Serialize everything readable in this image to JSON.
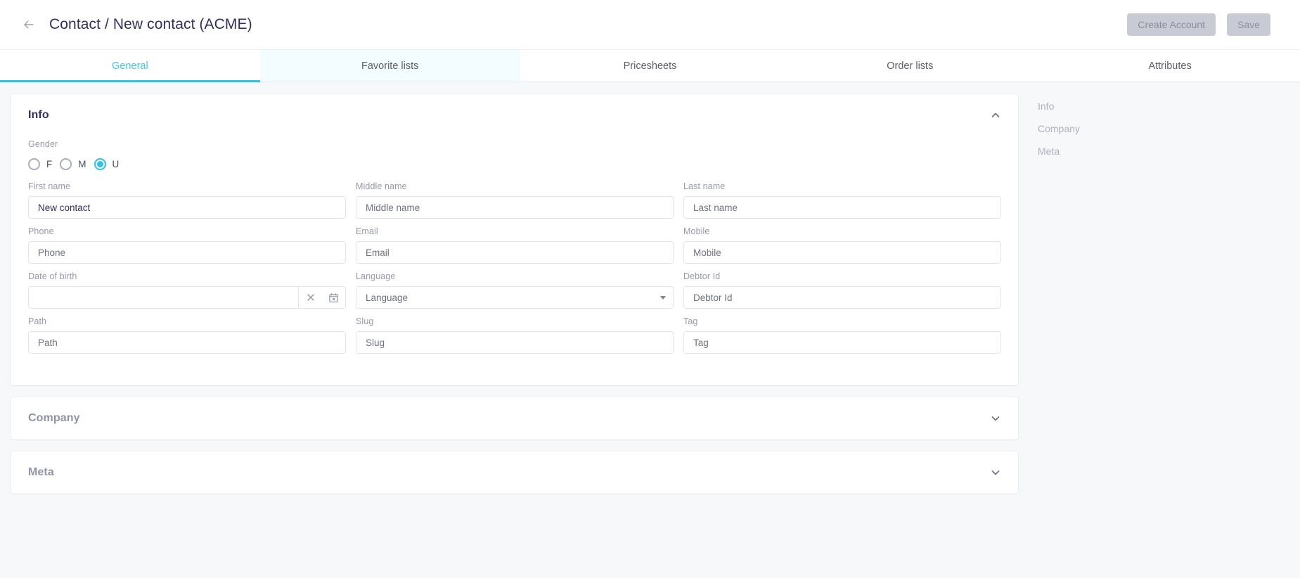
{
  "header": {
    "back_icon": "arrow-left-icon",
    "title": "Contact / New contact (ACME)",
    "create_account_label": "Create Account",
    "save_label": "Save"
  },
  "tabs": [
    {
      "label": "General",
      "state": "active"
    },
    {
      "label": "Favorite lists",
      "state": "hover"
    },
    {
      "label": "Pricesheets",
      "state": "default"
    },
    {
      "label": "Order lists",
      "state": "default"
    },
    {
      "label": "Attributes",
      "state": "default"
    }
  ],
  "sections": {
    "info": {
      "title": "Info",
      "collapsed": false,
      "chevron": "chevron-up-icon",
      "gender": {
        "label": "Gender",
        "options": [
          {
            "label": "F",
            "checked": false
          },
          {
            "label": "M",
            "checked": false
          },
          {
            "label": "U",
            "checked": true
          }
        ]
      },
      "fields": [
        [
          {
            "name": "first-name",
            "label": "First name",
            "value": "New contact",
            "placeholder": "First name",
            "filled": true,
            "type": "text"
          },
          {
            "name": "middle-name",
            "label": "Middle name",
            "value": "",
            "placeholder": "Middle name",
            "filled": false,
            "type": "text"
          },
          {
            "name": "last-name",
            "label": "Last name",
            "value": "",
            "placeholder": "Last name",
            "filled": false,
            "type": "text"
          }
        ],
        [
          {
            "name": "phone",
            "label": "Phone",
            "value": "",
            "placeholder": "Phone",
            "filled": false,
            "type": "text"
          },
          {
            "name": "email",
            "label": "Email",
            "value": "",
            "placeholder": "Email",
            "filled": false,
            "type": "text"
          },
          {
            "name": "mobile",
            "label": "Mobile",
            "value": "",
            "placeholder": "Mobile",
            "filled": false,
            "type": "text"
          }
        ],
        [
          {
            "name": "date-of-birth",
            "label": "Date of birth",
            "value": "",
            "placeholder": "",
            "filled": false,
            "type": "date",
            "clear_icon": "close-icon",
            "calendar_icon": "calendar-icon"
          },
          {
            "name": "language",
            "label": "Language",
            "value": "",
            "placeholder": "Language",
            "filled": false,
            "type": "select"
          },
          {
            "name": "debtor-id",
            "label": "Debtor Id",
            "value": "",
            "placeholder": "Debtor Id",
            "filled": false,
            "type": "text"
          }
        ],
        [
          {
            "name": "path",
            "label": "Path",
            "value": "",
            "placeholder": "Path",
            "filled": false,
            "type": "text"
          },
          {
            "name": "slug",
            "label": "Slug",
            "value": "",
            "placeholder": "Slug",
            "filled": false,
            "type": "text"
          },
          {
            "name": "tag",
            "label": "Tag",
            "value": "",
            "placeholder": "Tag",
            "filled": false,
            "type": "text"
          }
        ]
      ]
    },
    "company": {
      "title": "Company",
      "collapsed": true,
      "chevron": "chevron-down-icon"
    },
    "meta": {
      "title": "Meta",
      "collapsed": true,
      "chevron": "chevron-down-icon"
    }
  },
  "anchors": [
    {
      "label": "Info"
    },
    {
      "label": "Company"
    },
    {
      "label": "Meta"
    }
  ],
  "colors": {
    "accent": "#2ec0ef",
    "title": "#2f3061",
    "label": "#9599ad",
    "page_bg": "#f7f8fa"
  }
}
